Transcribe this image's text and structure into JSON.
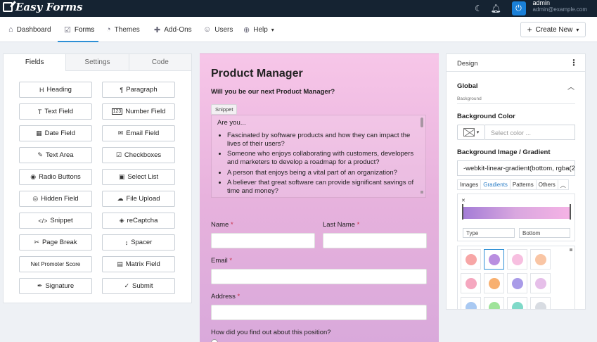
{
  "app": {
    "title": "Easy Forms"
  },
  "user": {
    "name": "admin",
    "email": "admin@example.com",
    "avatar_glyph": "⏻"
  },
  "top_icons": {
    "theme": "☾",
    "bell": "🔔︎"
  },
  "nav": {
    "items": [
      {
        "label": "Dashboard",
        "icon": "home-icon",
        "glyph": "⌂"
      },
      {
        "label": "Forms",
        "icon": "forms-icon",
        "glyph": "☑",
        "active": true
      },
      {
        "label": "Themes",
        "icon": "palette-icon",
        "glyph": "◔"
      },
      {
        "label": "Add-Ons",
        "icon": "puzzle-icon",
        "glyph": "✚"
      },
      {
        "label": "Users",
        "icon": "users-icon",
        "glyph": "☺"
      },
      {
        "label": "Help",
        "icon": "globe-icon",
        "glyph": "⊕",
        "chevron": "▾"
      }
    ],
    "create_button": {
      "plus": "+",
      "label": "Create New",
      "chevron": "▾"
    }
  },
  "builder_tabs": [
    "Fields",
    "Settings",
    "Code"
  ],
  "fields": [
    {
      "label": "Heading",
      "glyph": "H"
    },
    {
      "label": "Paragraph",
      "glyph": "¶"
    },
    {
      "label": "Text Field",
      "glyph": "T"
    },
    {
      "label": "Number Field",
      "glyph": "123"
    },
    {
      "label": "Date Field",
      "glyph": "▦"
    },
    {
      "label": "Email Field",
      "glyph": "✉"
    },
    {
      "label": "Text Area",
      "glyph": "✎"
    },
    {
      "label": "Checkboxes",
      "glyph": "☑"
    },
    {
      "label": "Radio Buttons",
      "glyph": "◉"
    },
    {
      "label": "Select List",
      "glyph": "▣"
    },
    {
      "label": "Hidden Field",
      "glyph": "◎"
    },
    {
      "label": "File Upload",
      "glyph": "☁"
    },
    {
      "label": "Snippet",
      "glyph": "</>"
    },
    {
      "label": "reCaptcha",
      "glyph": "◈"
    },
    {
      "label": "Page Break",
      "glyph": "✂"
    },
    {
      "label": "Spacer",
      "glyph": "↕"
    },
    {
      "label": "Net Promoter Score",
      "glyph": ""
    },
    {
      "label": "Matrix Field",
      "glyph": "▤"
    },
    {
      "label": "Signature",
      "glyph": "✒"
    },
    {
      "label": "Submit",
      "glyph": "✓"
    }
  ],
  "form": {
    "title": "Product Manager",
    "subtitle": "Will you be our next Product Manager?",
    "snippet_tag": "Snippet",
    "snippet_intro": "Are you...",
    "snippet_items": [
      "Fascinated by software products and how they can impact the lives of their users?",
      "Someone who enjoys collaborating with customers, developers and marketers to develop a roadmap for a product?",
      "A person that enjoys being a vital part of an organization?",
      "A believer that great software can provide significant savings of time and money?"
    ],
    "name_label": "Name",
    "last_name_label": "Last Name",
    "email_label": "Email",
    "address_label": "Address",
    "required_mark": "*",
    "question": "How did you find out about this position?"
  },
  "design": {
    "title": "Design",
    "menu_glyph": "⋮",
    "section": "Global",
    "section_chevron": "︿",
    "sub_label": "Background",
    "bg_color_label": "Background Color",
    "color_placeholder": "Select color ...",
    "bg_image_label": "Background Image / Gradient",
    "gradient_value": "-webkit-linear-gradient(bottom, rgba(2",
    "image_tabs": [
      "Images",
      "Gradients",
      "Patterns",
      "Others"
    ],
    "active_image_tab": "Gradients",
    "collapse_glyph": "︿",
    "gradient_type": "Type",
    "gradient_direction": "Bottom",
    "presets": [
      "#f7a6a6",
      "#b98ee0",
      "#f7bfe0",
      "#f9c5a4",
      "#f5a7bf",
      "#f8b070",
      "#a99be8",
      "#e6bfe9",
      "#a9c9f2",
      "#9fe39a",
      "#7fd9c8",
      "#d8dce2"
    ]
  }
}
